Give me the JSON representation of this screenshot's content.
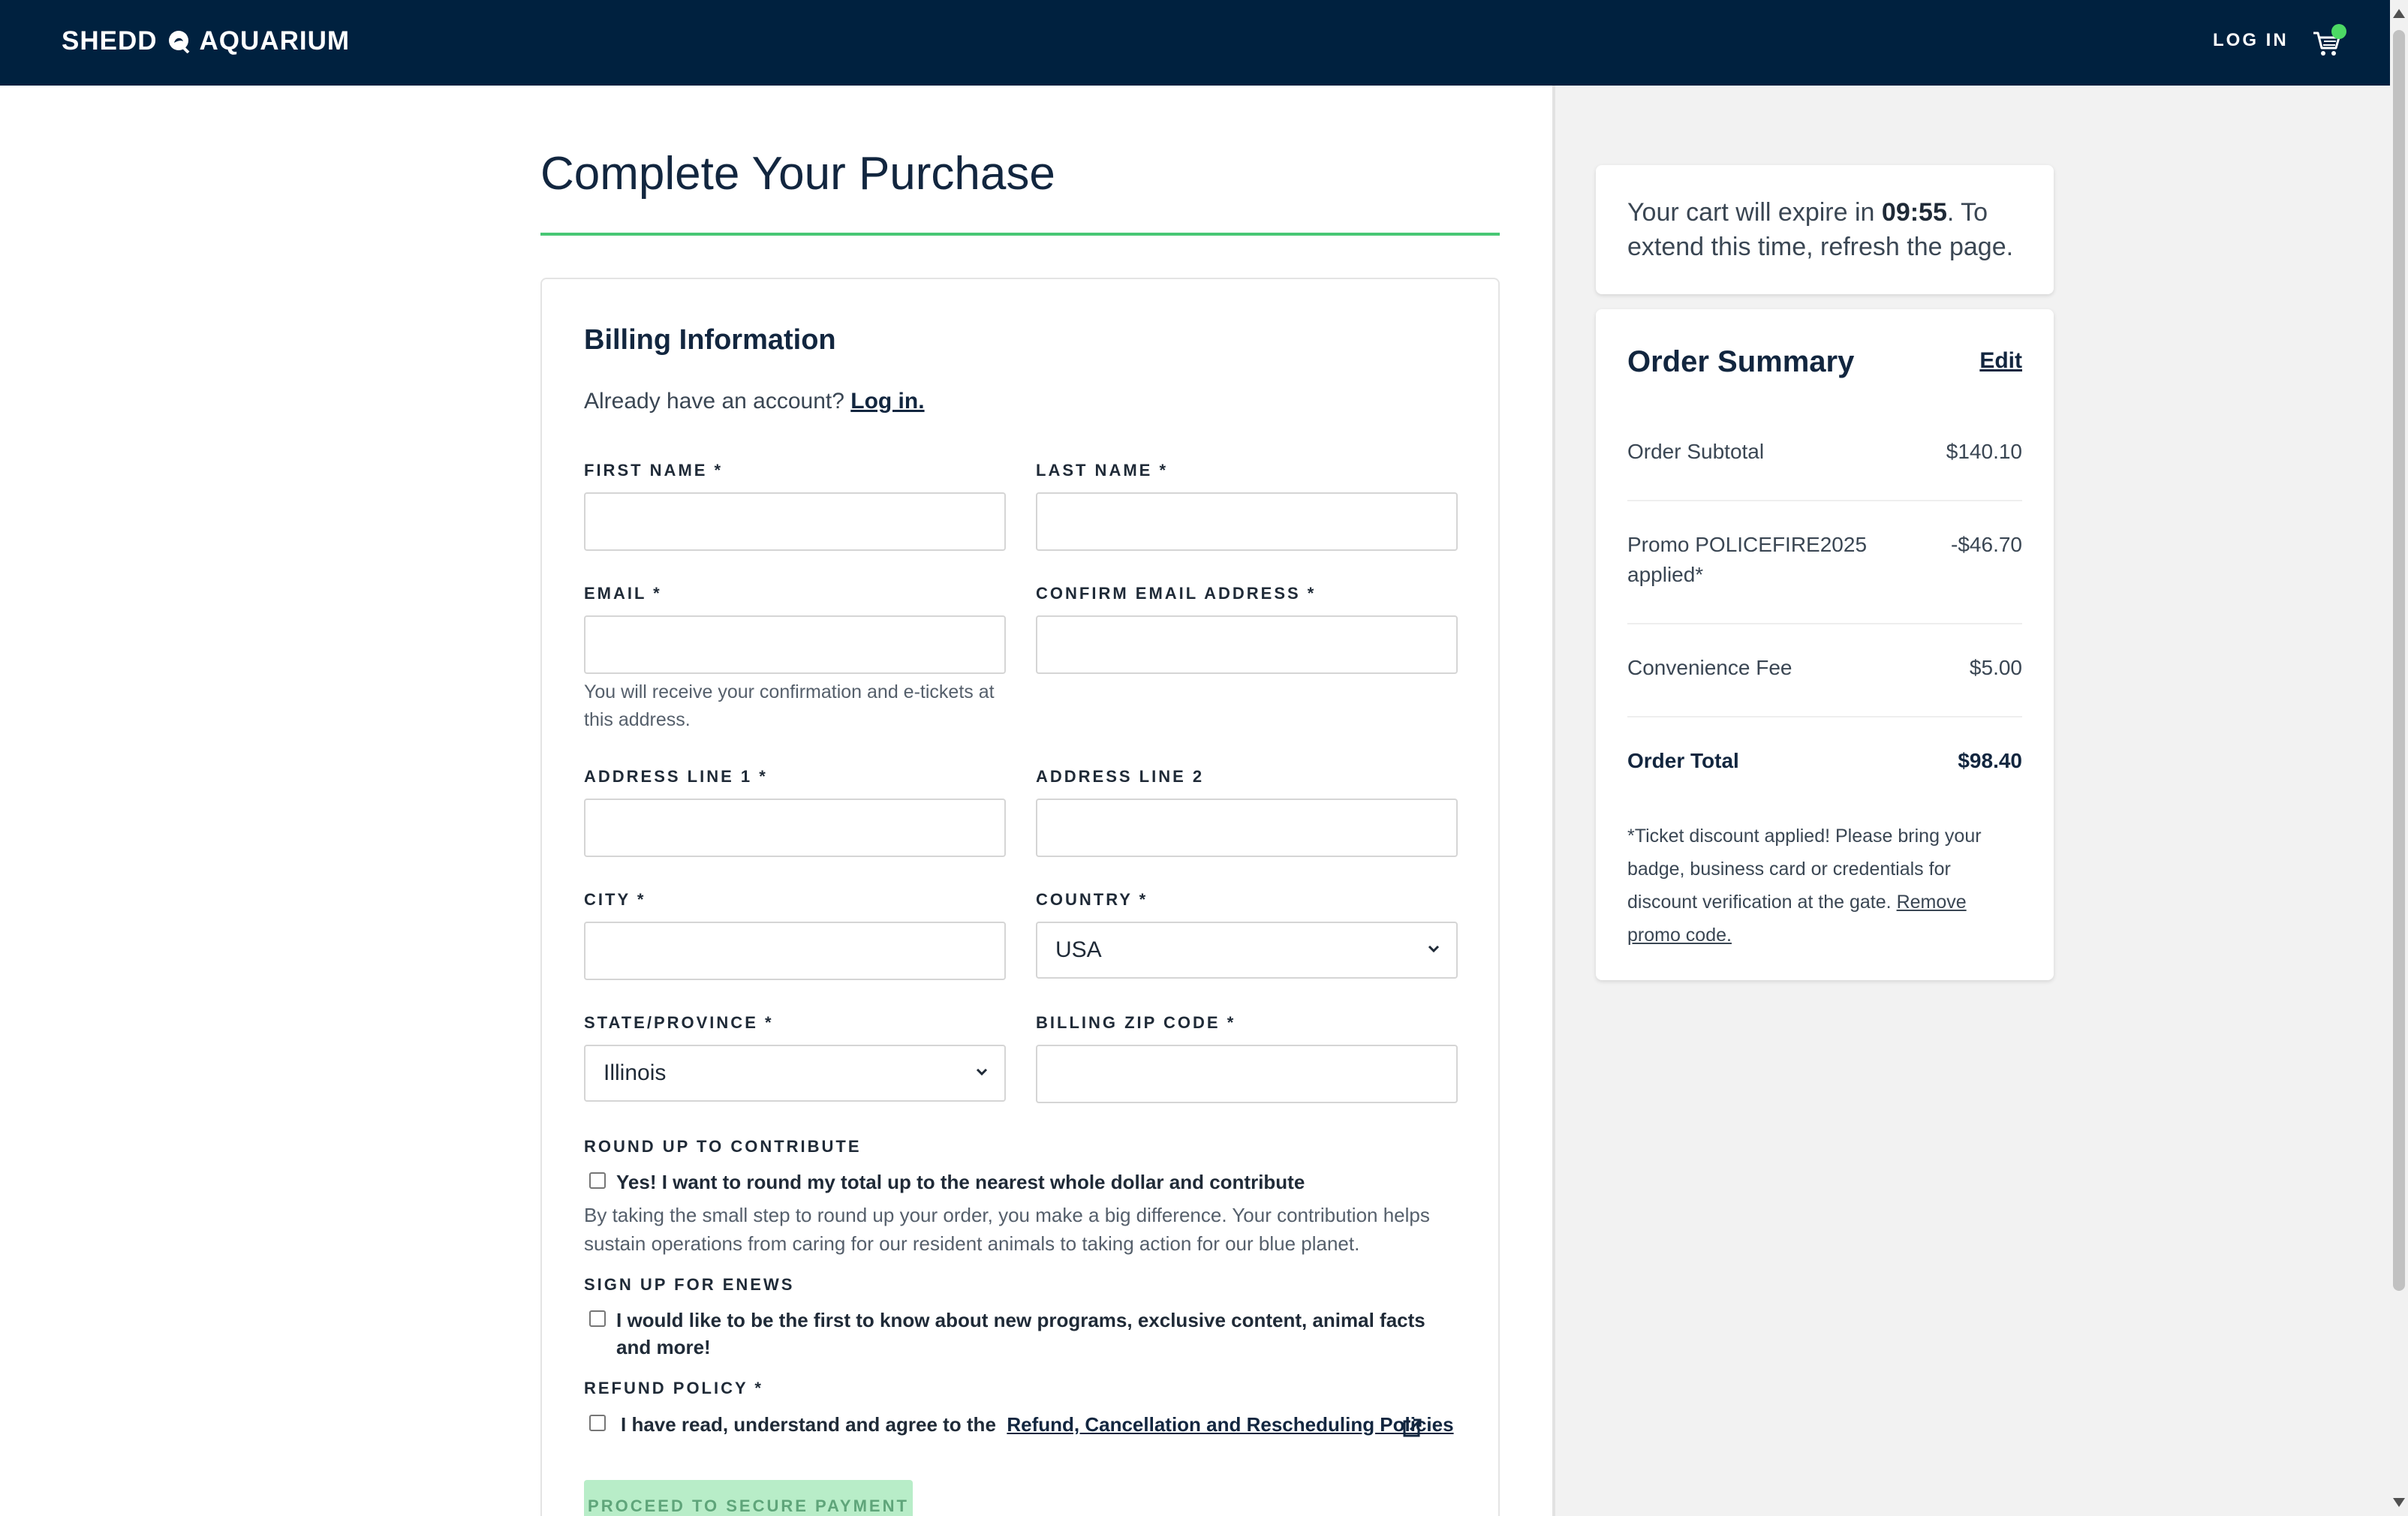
{
  "header": {
    "logo_left": "SHEDD",
    "logo_right": "AQUARIUM",
    "login_label": "LOG IN"
  },
  "page": {
    "title": "Complete Your Purchase"
  },
  "billing": {
    "heading": "Billing Information",
    "account_prompt": "Already have an account?",
    "login_link": "Log in.",
    "fields": {
      "first_name": "FIRST NAME *",
      "last_name": "LAST NAME *",
      "email": "EMAIL *",
      "confirm_email": "CONFIRM EMAIL ADDRESS *",
      "email_hint": "You will receive your confirmation and e-tickets at this address.",
      "address1": "ADDRESS LINE 1 *",
      "address2": "ADDRESS LINE 2",
      "city": "CITY *",
      "country": "COUNTRY *",
      "country_value": "USA",
      "state": "STATE/PROVINCE *",
      "state_value": "Illinois",
      "zip": "BILLING ZIP CODE *"
    },
    "roundup": {
      "heading": "ROUND UP TO CONTRIBUTE",
      "label": "Yes! I want to round my total up to the nearest whole dollar and contribute",
      "desc": "By taking the small step to round up your order, you make a big difference. Your contribution helps sustain operations from caring for our resident animals to taking action for our blue planet."
    },
    "enews": {
      "heading": "SIGN UP FOR ENEWS",
      "label": "I would like to be the first to know about new programs, exclusive content, animal facts and more!"
    },
    "refund": {
      "heading": "REFUND POLICY *",
      "label": "I have read, understand and agree to the",
      "link": "Refund, Cancellation and Rescheduling Policies"
    },
    "proceed_label": "PROCEED TO SECURE PAYMENT"
  },
  "timer": {
    "prefix": "Your cart will expire in",
    "time": "09:55",
    "suffix": ". To extend this time, refresh the page."
  },
  "summary": {
    "heading": "Order Summary",
    "edit_label": "Edit",
    "rows": [
      {
        "label": "Order Subtotal",
        "value": "$140.10"
      },
      {
        "label": "Promo POLICEFIRE2025 applied*",
        "value": "-$46.70"
      },
      {
        "label": "Convenience Fee",
        "value": "$5.00"
      },
      {
        "label": "Order Total",
        "value": "$98.40"
      }
    ],
    "disclaimer": "*Ticket discount applied! Please bring your badge, business card or credentials for discount verification at the gate.",
    "remove_link": "Remove promo code."
  }
}
